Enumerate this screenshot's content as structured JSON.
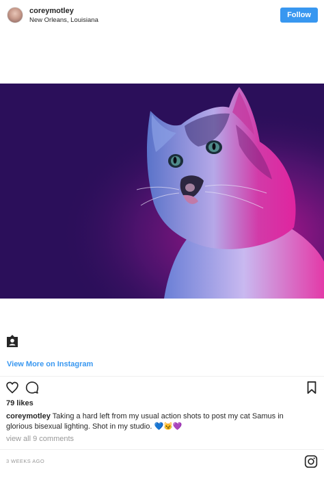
{
  "header": {
    "username": "coreymotley",
    "location": "New Orleans, Louisiana",
    "follow_label": "Follow"
  },
  "post": {
    "image_subject": "cat portrait with blue and magenta lighting",
    "view_more_label": "View More on Instagram",
    "likes": "79 likes",
    "caption_user": "coreymotley",
    "caption_text": "Taking a hard left from my usual action shots to post my cat Samus in glorious bisexual lighting. Shot in my studio. 💙😼💜",
    "view_comments": "view all 9 comments",
    "timestamp": "3 WEEKS AGO"
  },
  "icons": {
    "avatar": "profile-photo",
    "profile_badge": "person-badge-icon",
    "like": "heart-icon",
    "comment": "speech-bubble-icon",
    "bookmark": "bookmark-icon",
    "instagram": "instagram-logo-icon"
  },
  "colors": {
    "follow_button": "#3897f0",
    "link_blue": "#3897f0",
    "muted_text": "#999999",
    "photo_background": "#2a0e57"
  }
}
